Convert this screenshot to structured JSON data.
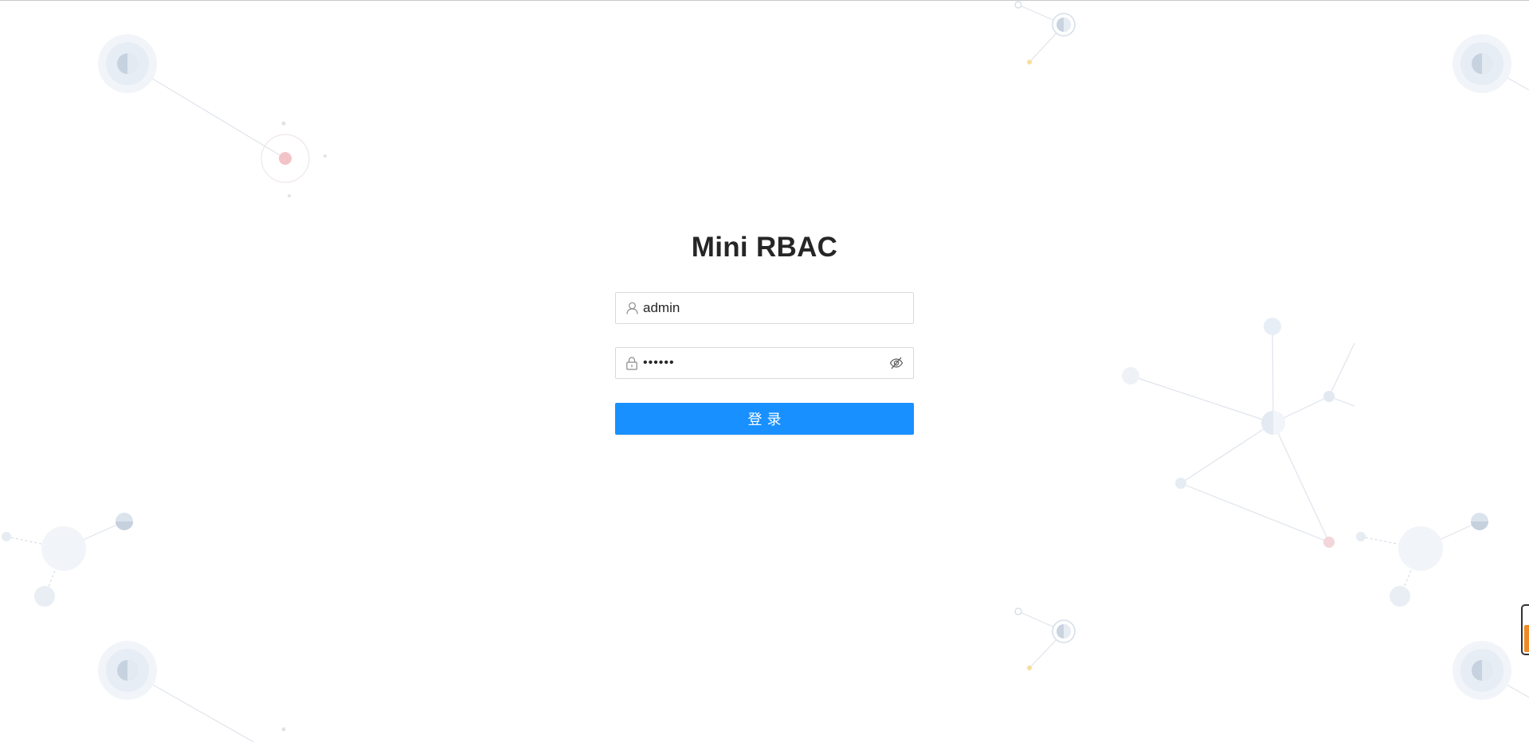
{
  "app": {
    "title": "Mini RBAC"
  },
  "login": {
    "username": {
      "value": "admin",
      "icon": "user-icon"
    },
    "password": {
      "value": "123456",
      "icon": "lock-icon",
      "toggle_icon": "eye-invisible-icon"
    },
    "submit_label": "登录"
  },
  "colors": {
    "primary": "#1890ff",
    "title": "#262626",
    "border": "#d9d9d9",
    "decor_node": "#e6edf5",
    "decor_accent_red": "#f2c4c8",
    "decor_accent_yellow": "#f8dd9c",
    "widget_fill": "#f08a24"
  }
}
